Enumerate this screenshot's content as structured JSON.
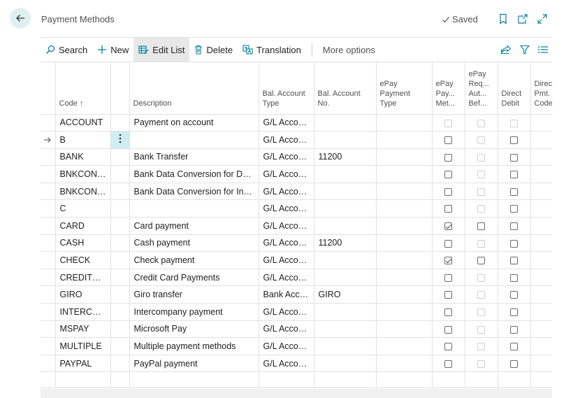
{
  "header": {
    "title": "Payment Methods",
    "saved_label": "Saved"
  },
  "actions": {
    "search": "Search",
    "new": "New",
    "edit_list": "Edit List",
    "delete": "Delete",
    "translation": "Translation",
    "more_options": "More options"
  },
  "columns": {
    "code": "Code ↑",
    "description": "Description",
    "bal_type": [
      "Bal. Account",
      "Type"
    ],
    "bal_no": [
      "Bal. Account",
      "No."
    ],
    "epay_type": [
      "ePay",
      "Payment",
      "Type"
    ],
    "epay_pay": [
      "ePay",
      "Pay...",
      "Met..."
    ],
    "epay_req": [
      "ePay",
      "Req...",
      "Aut...",
      "Bef..."
    ],
    "direct_debit": [
      "Direct",
      "Debit"
    ],
    "direct_pmt": [
      "Direc",
      "Pmt.",
      "Code"
    ]
  },
  "rows": [
    {
      "code": "ACCOUNT",
      "description": "Payment on account",
      "bal_type": "G/L Account",
      "bal_no": "",
      "epay_pay": "disabled",
      "epay_req": "disabled",
      "direct_debit": "disabled"
    },
    {
      "code": "B",
      "description": "",
      "bal_type": "G/L Account",
      "bal_no": "",
      "epay_pay": "off",
      "epay_req": "disabled",
      "direct_debit": "off",
      "selected": true
    },
    {
      "code": "BANK",
      "description": "Bank Transfer",
      "bal_type": "G/L Account",
      "bal_no": "11200",
      "epay_pay": "off",
      "epay_req": "disabled",
      "direct_debit": "off"
    },
    {
      "code": "BNKCONV...",
      "description": "Bank Data Conversion for Do...",
      "bal_type": "G/L Account",
      "bal_no": "",
      "epay_pay": "off",
      "epay_req": "disabled",
      "direct_debit": "off"
    },
    {
      "code": "BNKCONVI...",
      "description": "Bank Data Conversion for Inter...",
      "bal_type": "G/L Account",
      "bal_no": "",
      "epay_pay": "off",
      "epay_req": "disabled",
      "direct_debit": "off"
    },
    {
      "code": "C",
      "description": "",
      "bal_type": "G/L Account",
      "bal_no": "",
      "epay_pay": "off",
      "epay_req": "disabled",
      "direct_debit": "off"
    },
    {
      "code": "CARD",
      "description": "Card payment",
      "bal_type": "G/L Account",
      "bal_no": "",
      "epay_pay": "on",
      "epay_req": "off",
      "direct_debit": "off"
    },
    {
      "code": "CASH",
      "description": "Cash payment",
      "bal_type": "G/L Account",
      "bal_no": "11200",
      "epay_pay": "off",
      "epay_req": "disabled",
      "direct_debit": "off"
    },
    {
      "code": "CHECK",
      "description": "Check payment",
      "bal_type": "G/L Account",
      "bal_no": "",
      "epay_pay": "on",
      "epay_req": "off",
      "direct_debit": "off"
    },
    {
      "code": "CREDITCARD",
      "description": "Credit Card Payments",
      "bal_type": "G/L Account",
      "bal_no": "",
      "epay_pay": "off",
      "epay_req": "disabled",
      "direct_debit": "off"
    },
    {
      "code": "GIRO",
      "description": "Giro transfer",
      "bal_type": "Bank Acco...",
      "bal_no": "GIRO",
      "epay_pay": "off",
      "epay_req": "disabled",
      "direct_debit": "off"
    },
    {
      "code": "INTERCOM",
      "description": "Intercompany payment",
      "bal_type": "G/L Account",
      "bal_no": "",
      "epay_pay": "off",
      "epay_req": "disabled",
      "direct_debit": "off"
    },
    {
      "code": "MSPAY",
      "description": "Microsoft Pay",
      "bal_type": "G/L Account",
      "bal_no": "",
      "epay_pay": "off",
      "epay_req": "disabled",
      "direct_debit": "off"
    },
    {
      "code": "MULTIPLE",
      "description": "Multiple payment methods",
      "bal_type": "G/L Account",
      "bal_no": "",
      "epay_pay": "off",
      "epay_req": "disabled",
      "direct_debit": "off"
    },
    {
      "code": "PAYPAL",
      "description": "PayPal payment",
      "bal_type": "G/L Account",
      "bal_no": "",
      "epay_pay": "off",
      "epay_req": "disabled",
      "direct_debit": "off"
    }
  ],
  "colors": {
    "accent": "#00809d",
    "selected_cell": "#cfeef3",
    "back_button_bg": "#dff0f3"
  }
}
